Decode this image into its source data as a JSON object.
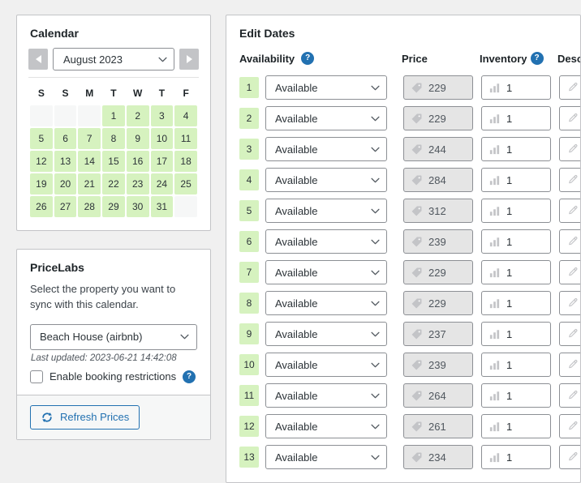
{
  "calendar": {
    "title": "Calendar",
    "prev_label": "◀",
    "next_label": "▶",
    "month_value": "August 2023",
    "weekday_headers": [
      "S",
      "S",
      "M",
      "T",
      "W",
      "T",
      "F"
    ],
    "weeks": [
      [
        "",
        "",
        "",
        "1",
        "2",
        "3",
        "4"
      ],
      [
        "5",
        "6",
        "7",
        "8",
        "9",
        "10",
        "11"
      ],
      [
        "12",
        "13",
        "14",
        "15",
        "16",
        "17",
        "18"
      ],
      [
        "19",
        "20",
        "21",
        "22",
        "23",
        "24",
        "25"
      ],
      [
        "26",
        "27",
        "28",
        "29",
        "30",
        "31",
        ""
      ]
    ]
  },
  "pricelabs": {
    "title": "PriceLabs",
    "description": "Select the property you want to sync with this calendar.",
    "property_value": "Beach House (airbnb)",
    "last_updated": "Last updated: 2023-06-21 14:42:08",
    "restrictions_label": "Enable booking restrictions",
    "restrictions_help": "?",
    "restrictions_checked": false,
    "refresh_label": "Refresh Prices",
    "refresh_icon": "refresh-icon"
  },
  "edit_dates": {
    "title": "Edit Dates",
    "columns": {
      "availability": "Availability",
      "availability_help": "?",
      "price": "Price",
      "inventory": "Inventory",
      "inventory_help": "?",
      "description": "Descri"
    },
    "rows": [
      {
        "day": "1",
        "availability": "Available",
        "price": "229",
        "inventory": "1",
        "description": ""
      },
      {
        "day": "2",
        "availability": "Available",
        "price": "229",
        "inventory": "1",
        "description": ""
      },
      {
        "day": "3",
        "availability": "Available",
        "price": "244",
        "inventory": "1",
        "description": ""
      },
      {
        "day": "4",
        "availability": "Available",
        "price": "284",
        "inventory": "1",
        "description": ""
      },
      {
        "day": "5",
        "availability": "Available",
        "price": "312",
        "inventory": "1",
        "description": ""
      },
      {
        "day": "6",
        "availability": "Available",
        "price": "239",
        "inventory": "1",
        "description": ""
      },
      {
        "day": "7",
        "availability": "Available",
        "price": "229",
        "inventory": "1",
        "description": ""
      },
      {
        "day": "8",
        "availability": "Available",
        "price": "229",
        "inventory": "1",
        "description": ""
      },
      {
        "day": "9",
        "availability": "Available",
        "price": "237",
        "inventory": "1",
        "description": ""
      },
      {
        "day": "10",
        "availability": "Available",
        "price": "239",
        "inventory": "1",
        "description": ""
      },
      {
        "day": "11",
        "availability": "Available",
        "price": "264",
        "inventory": "1",
        "description": ""
      },
      {
        "day": "12",
        "availability": "Available",
        "price": "261",
        "inventory": "1",
        "description": ""
      },
      {
        "day": "13",
        "availability": "Available",
        "price": "234",
        "inventory": "1",
        "description": ""
      }
    ]
  },
  "colors": {
    "page_background": "#f0f0f0",
    "card_background": "#ffffff",
    "border": "#c3c4c7",
    "available_green": "#d6f2bf",
    "accent_blue": "#2271b1",
    "disabled_field": "#e5e5e5",
    "text": "#3c434a"
  }
}
